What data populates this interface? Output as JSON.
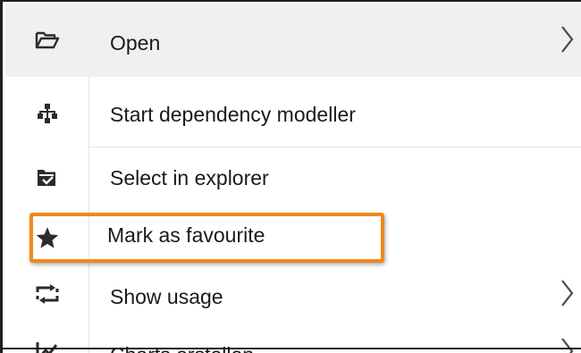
{
  "menu": {
    "items": [
      {
        "label": "Open",
        "icon": "folder-open-icon",
        "has_submenu": true
      },
      {
        "label": "Start dependency modeller",
        "icon": "hierarchy-icon",
        "has_submenu": false
      },
      {
        "label": "Select in explorer",
        "icon": "folder-check-icon",
        "has_submenu": false
      },
      {
        "label": "Mark as favourite",
        "icon": "star-icon",
        "has_submenu": false
      },
      {
        "label": "Show usage",
        "icon": "usage-arrows-icon",
        "has_submenu": true
      },
      {
        "label": "Charts erstellen",
        "icon": "chart-line-icon",
        "has_submenu": true
      }
    ]
  },
  "colors": {
    "highlight_border": "#f0891c",
    "hover_background": "#f0f0f0",
    "text": "#1a1a1a",
    "icon": "#2b2b2b"
  }
}
